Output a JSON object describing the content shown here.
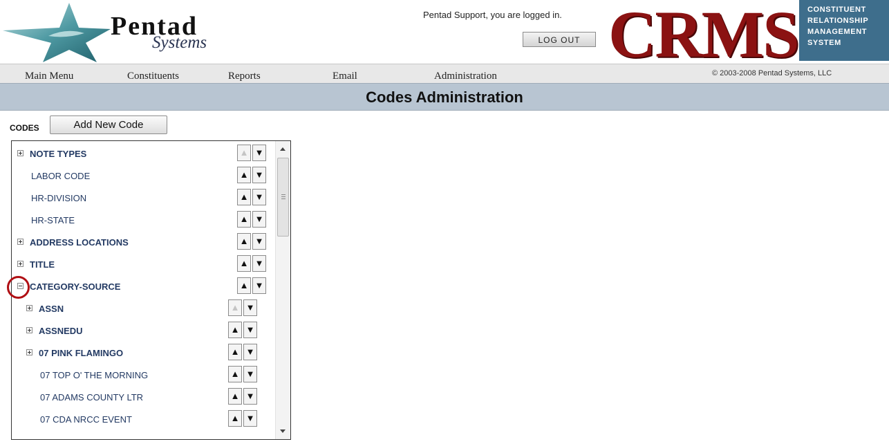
{
  "brand": {
    "logo_word": "Pentad",
    "logo_sub": "Systems",
    "crms_word": "CRMS",
    "crms_box_lines": [
      "CONSTITUENT",
      "RELATIONSHIP",
      "MANAGEMENT",
      "SYSTEM"
    ]
  },
  "session": {
    "login_text": "Pentad Support, you are logged in.",
    "logout_label": "LOG OUT"
  },
  "nav": {
    "items": [
      "Main Menu",
      "Constituents",
      "Reports",
      "Email",
      "Administration"
    ],
    "copyright": "© 2003-2008 Pentad Systems, LLC"
  },
  "page": {
    "title": "Codes Administration"
  },
  "codes": {
    "label": "CODES",
    "add_button": "Add New Code",
    "rows": [
      {
        "label": "NOTE TYPES",
        "bold": true,
        "expander": "plus",
        "level": 0,
        "up_disabled": true
      },
      {
        "label": "LABOR CODE",
        "bold": false,
        "expander": "none",
        "level": 0,
        "up_disabled": false
      },
      {
        "label": "HR-DIVISION",
        "bold": false,
        "expander": "none",
        "level": 0,
        "up_disabled": false
      },
      {
        "label": "HR-STATE",
        "bold": false,
        "expander": "none",
        "level": 0,
        "up_disabled": false
      },
      {
        "label": "ADDRESS LOCATIONS",
        "bold": true,
        "expander": "plus",
        "level": 0,
        "up_disabled": false
      },
      {
        "label": "TITLE",
        "bold": true,
        "expander": "plus",
        "level": 0,
        "up_disabled": false
      },
      {
        "label": "CATEGORY-SOURCE",
        "bold": true,
        "expander": "minus",
        "level": 0,
        "up_disabled": false
      },
      {
        "label": "ASSN",
        "bold": true,
        "expander": "plus",
        "level": 1,
        "up_disabled": true
      },
      {
        "label": "ASSNEDU",
        "bold": true,
        "expander": "plus",
        "level": 1,
        "up_disabled": false
      },
      {
        "label": "07 PINK FLAMINGO",
        "bold": true,
        "expander": "plus",
        "level": 1,
        "up_disabled": false
      },
      {
        "label": "07 TOP O' THE MORNING",
        "bold": false,
        "expander": "none",
        "level": 1,
        "up_disabled": false
      },
      {
        "label": "07 ADAMS COUNTY LTR",
        "bold": false,
        "expander": "none",
        "level": 1,
        "up_disabled": false
      },
      {
        "label": "07 CDA NRCC EVENT",
        "bold": false,
        "expander": "none",
        "level": 1,
        "up_disabled": false
      }
    ]
  },
  "colors": {
    "crms_red": "#8b1212",
    "crms_box": "#3e6e8c",
    "title_bar": "#b8c5d2",
    "highlight_circle": "#b00f14",
    "link_text": "#233a63"
  }
}
